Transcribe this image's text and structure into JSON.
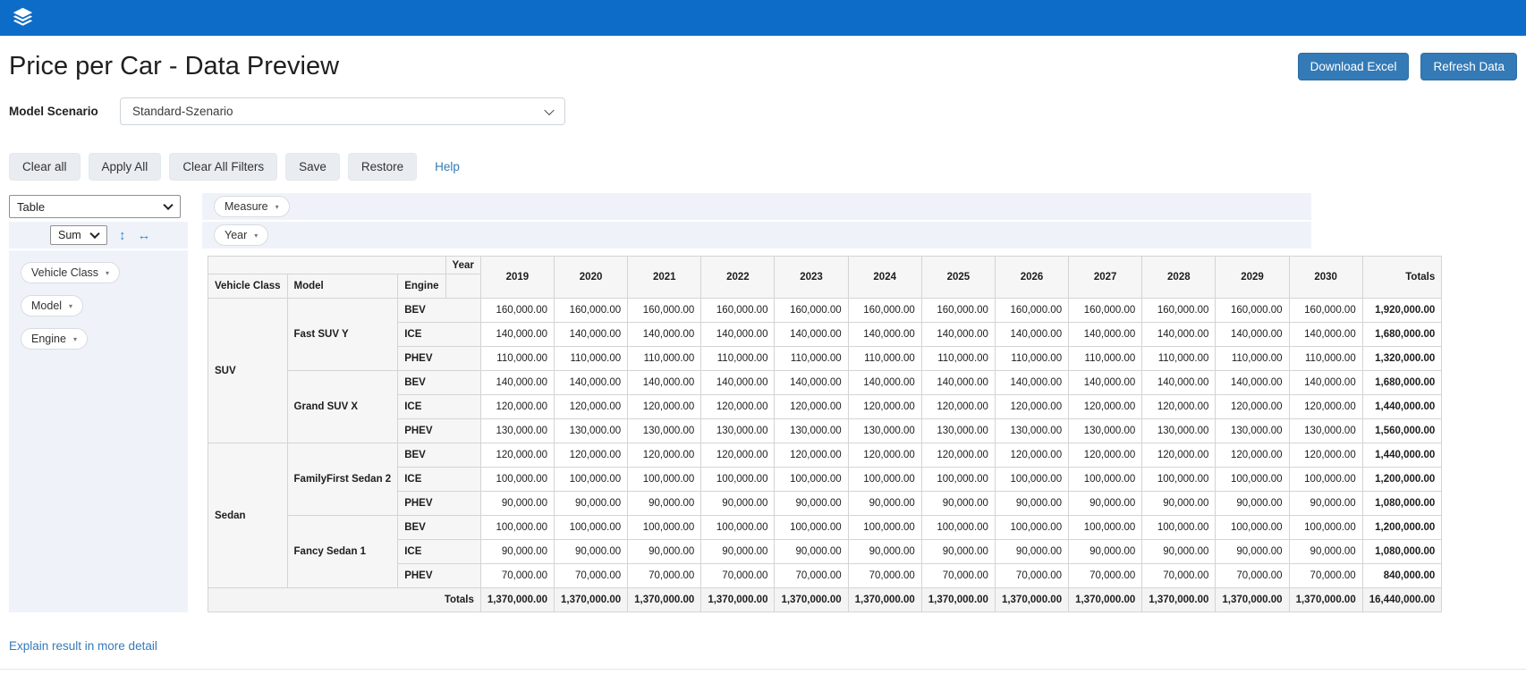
{
  "colors": {
    "topbar_blue": "#0d6cc8",
    "primary_button_blue": "#337ab7",
    "link_blue": "#337ab7"
  },
  "topbar": {
    "logo_icon": "layers-icon"
  },
  "header": {
    "title": "Price per Car - Data Preview",
    "download_button": "Download Excel",
    "refresh_button": "Refresh Data"
  },
  "scenario": {
    "label": "Model Scenario",
    "selected_option": "Standard-Szenario"
  },
  "toolbar": {
    "buttons": [
      "Clear all",
      "Apply All",
      "Clear All Filters",
      "Save",
      "Restore"
    ],
    "help_label": "Help"
  },
  "pivot_controls": {
    "view_select_value": "Table",
    "aggregation_select_value": "Sum",
    "vertical_resize_icon": "↕",
    "horizontal_resize_icon": "↔",
    "measure_pill": "Measure",
    "column_pill": "Year",
    "row_pills": [
      "Vehicle Class",
      "Model",
      "Engine"
    ]
  },
  "pivot_table": {
    "column_dimension_label": "Year",
    "row_header_labels": [
      "Vehicle Class",
      "Model",
      "Engine"
    ],
    "year_columns": [
      "2019",
      "2020",
      "2021",
      "2022",
      "2023",
      "2024",
      "2025",
      "2026",
      "2027",
      "2028",
      "2029",
      "2030"
    ],
    "totals_column_label": "Totals",
    "rows": [
      {
        "vehicle_class": "SUV",
        "model": "Fast SUV Y",
        "engine": "BEV",
        "year_value": "160,000.00",
        "row_total": "1,920,000.00"
      },
      {
        "vehicle_class": "SUV",
        "model": "Fast SUV Y",
        "engine": "ICE",
        "year_value": "140,000.00",
        "row_total": "1,680,000.00"
      },
      {
        "vehicle_class": "SUV",
        "model": "Fast SUV Y",
        "engine": "PHEV",
        "year_value": "110,000.00",
        "row_total": "1,320,000.00"
      },
      {
        "vehicle_class": "SUV",
        "model": "Grand SUV X",
        "engine": "BEV",
        "year_value": "140,000.00",
        "row_total": "1,680,000.00"
      },
      {
        "vehicle_class": "SUV",
        "model": "Grand SUV X",
        "engine": "ICE",
        "year_value": "120,000.00",
        "row_total": "1,440,000.00"
      },
      {
        "vehicle_class": "SUV",
        "model": "Grand SUV X",
        "engine": "PHEV",
        "year_value": "130,000.00",
        "row_total": "1,560,000.00"
      },
      {
        "vehicle_class": "Sedan",
        "model": "FamilyFirst Sedan 2",
        "engine": "BEV",
        "year_value": "120,000.00",
        "row_total": "1,440,000.00"
      },
      {
        "vehicle_class": "Sedan",
        "model": "FamilyFirst Sedan 2",
        "engine": "ICE",
        "year_value": "100,000.00",
        "row_total": "1,200,000.00"
      },
      {
        "vehicle_class": "Sedan",
        "model": "FamilyFirst Sedan 2",
        "engine": "PHEV",
        "year_value": "90,000.00",
        "row_total": "1,080,000.00"
      },
      {
        "vehicle_class": "Sedan",
        "model": "Fancy Sedan 1",
        "engine": "BEV",
        "year_value": "100,000.00",
        "row_total": "1,200,000.00"
      },
      {
        "vehicle_class": "Sedan",
        "model": "Fancy Sedan 1",
        "engine": "ICE",
        "year_value": "90,000.00",
        "row_total": "1,080,000.00"
      },
      {
        "vehicle_class": "Sedan",
        "model": "Fancy Sedan 1",
        "engine": "PHEV",
        "year_value": "70,000.00",
        "row_total": "840,000.00"
      }
    ],
    "totals_row": {
      "label": "Totals",
      "year_value": "1,370,000.00",
      "grand_total": "16,440,000.00"
    }
  },
  "footer": {
    "explain_link": "Explain result in more detail"
  }
}
